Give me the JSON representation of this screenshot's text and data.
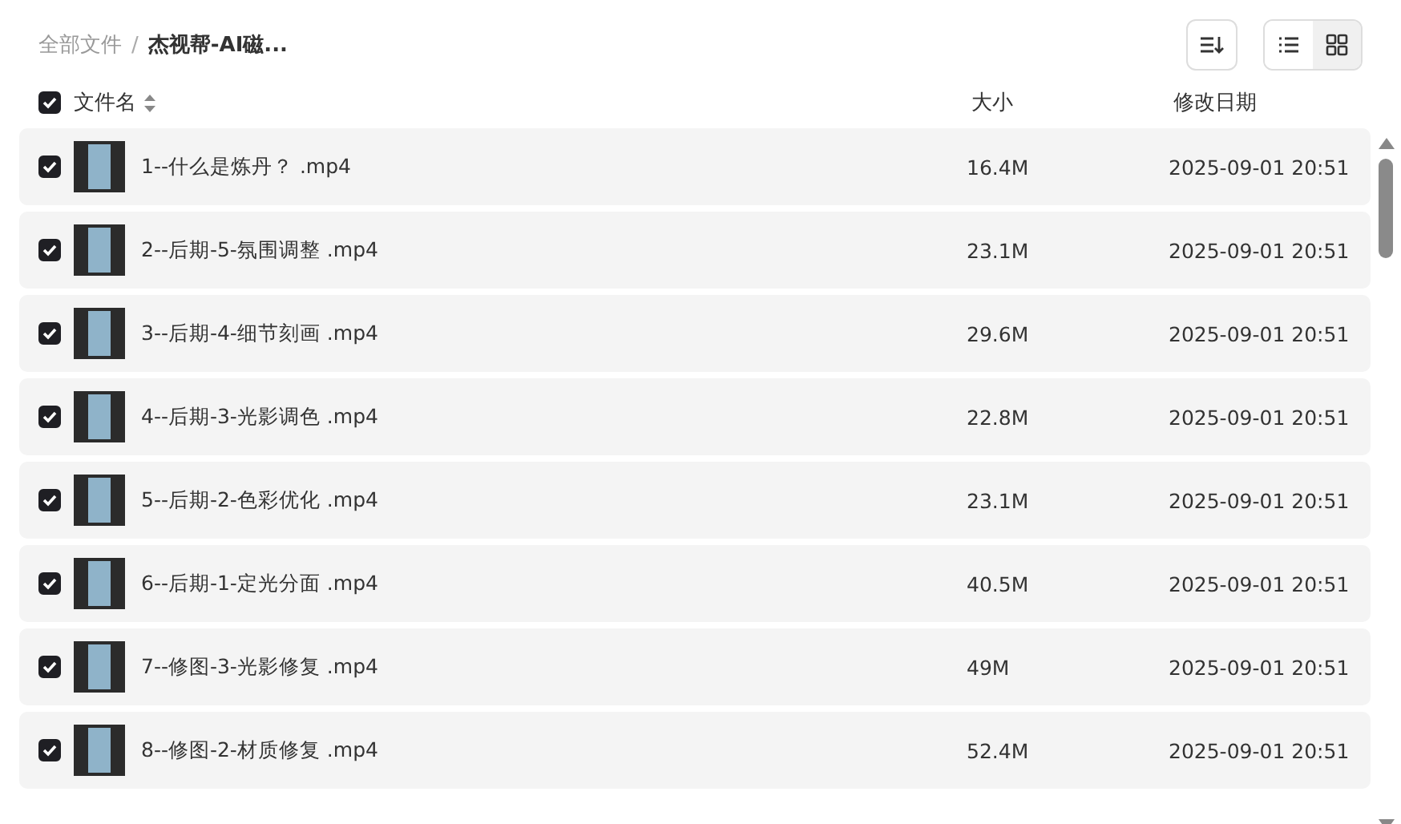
{
  "breadcrumb_separator": "/",
  "breadcrumb": [
    {
      "label": "全部文件",
      "current": false
    },
    {
      "label": "杰视帮-AI磁...",
      "current": true
    }
  ],
  "view_toggle": [
    {
      "kind": "list",
      "selected": false
    },
    {
      "kind": "grid",
      "selected": true
    }
  ],
  "header": {
    "checked": true,
    "columns": [
      "文件名",
      "大小",
      "修改日期"
    ]
  },
  "files": [
    {
      "name": "1--什么是炼丹？ .mp4",
      "size": "16.4M",
      "modified": "2025-09-01 20:51",
      "checked": true
    },
    {
      "name": "2--后期-5-氛围调整 .mp4",
      "size": "23.1M",
      "modified": "2025-09-01 20:51",
      "checked": true
    },
    {
      "name": "3--后期-4-细节刻画 .mp4",
      "size": "29.6M",
      "modified": "2025-09-01 20:51",
      "checked": true
    },
    {
      "name": "4--后期-3-光影调色 .mp4",
      "size": "22.8M",
      "modified": "2025-09-01 20:51",
      "checked": true
    },
    {
      "name": "5--后期-2-色彩优化 .mp4",
      "size": "23.1M",
      "modified": "2025-09-01 20:51",
      "checked": true
    },
    {
      "name": "6--后期-1-定光分面 .mp4",
      "size": "40.5M",
      "modified": "2025-09-01 20:51",
      "checked": true
    },
    {
      "name": "7--修图-3-光影修复 .mp4",
      "size": "49M",
      "modified": "2025-09-01 20:51",
      "checked": true
    },
    {
      "name": "8--修图-2-材质修复 .mp4",
      "size": "52.4M",
      "modified": "2025-09-01 20:51",
      "checked": true
    }
  ]
}
